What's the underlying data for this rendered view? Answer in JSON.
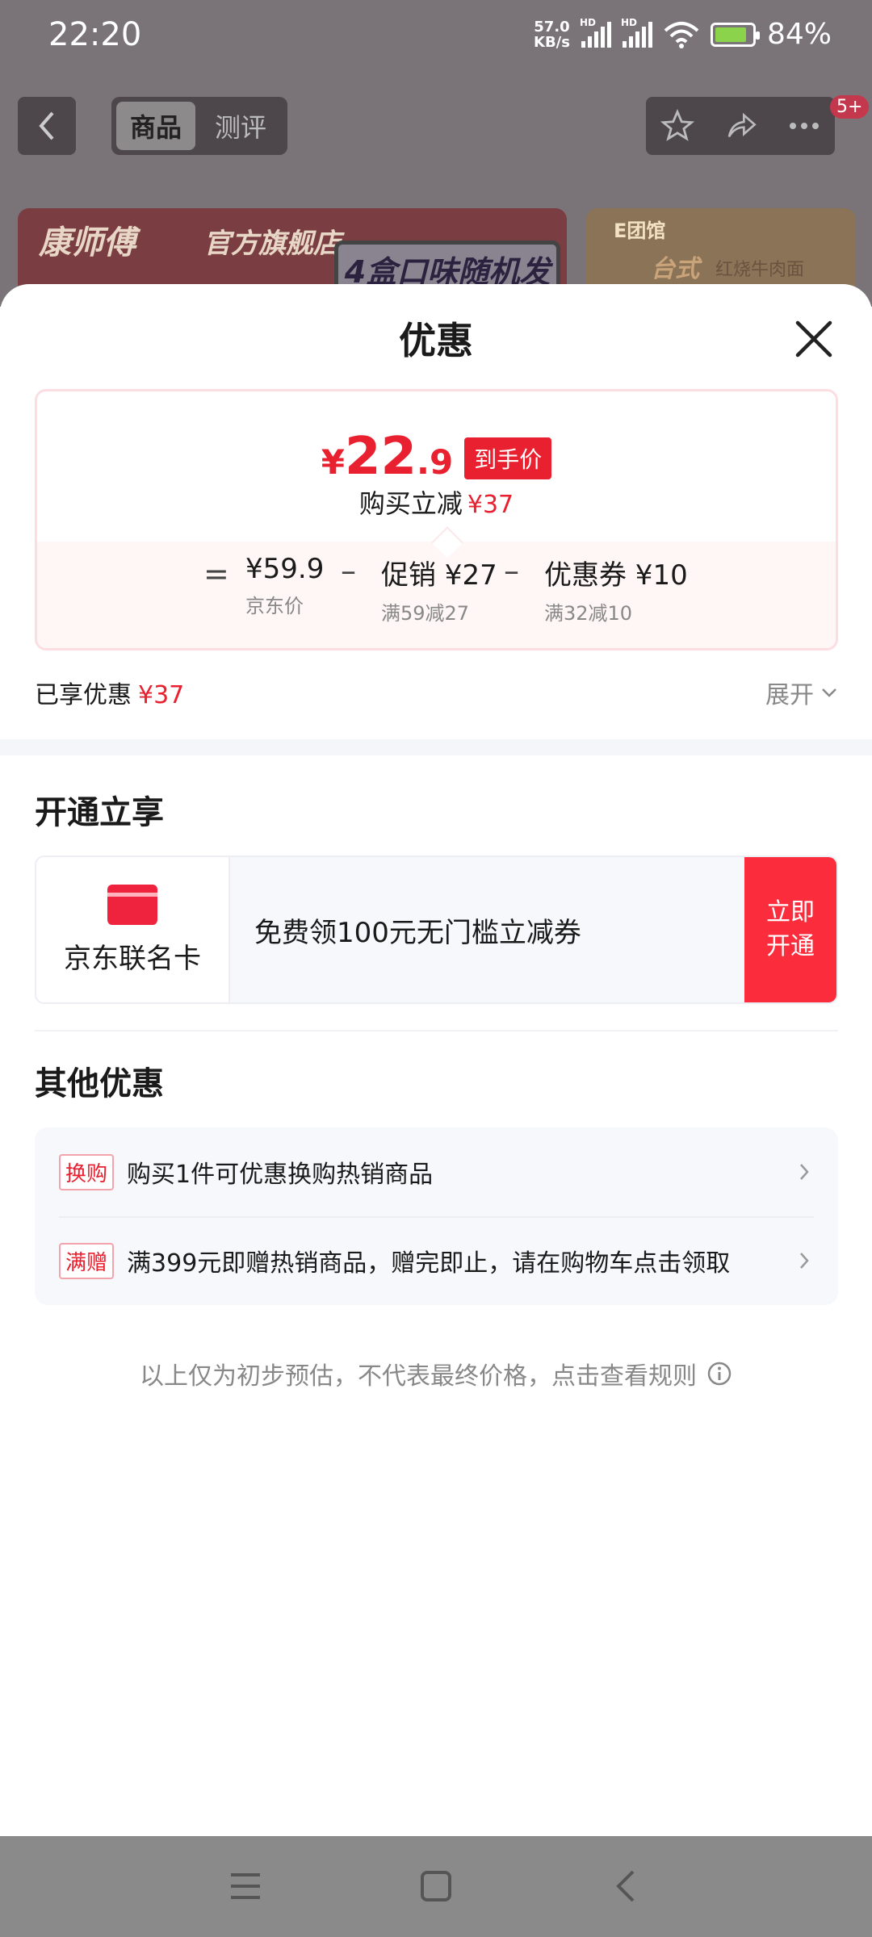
{
  "status_bar": {
    "time": "22:20",
    "net_speed_value": "57.0",
    "net_speed_unit": "KB/s",
    "sig1_label": "HD",
    "sig2_label": "HD",
    "battery": "84%"
  },
  "top_nav": {
    "tabs": [
      "商品",
      "测评"
    ],
    "active_tab": "商品",
    "badge": "5+"
  },
  "background_banners": {
    "left_brand": "康师傅",
    "left_flag": "官方旗舰店",
    "left_tag": "4盒口味随机发",
    "right_logo": "E团馆",
    "right_title": "台式",
    "right_sub": "红烧牛肉面"
  },
  "sheet": {
    "title": "优惠"
  },
  "price_card": {
    "currency": "¥",
    "price_int": "22",
    "price_dec": ".9",
    "final_label": "到手价",
    "reduce_label": "购买立减",
    "reduce_value": "¥37",
    "eq": "=",
    "minus": "–",
    "items": [
      {
        "value": "¥59.9",
        "caption": "京东价"
      },
      {
        "value": "促销 ¥27",
        "caption": "满59减27"
      },
      {
        "value": "优惠券 ¥10",
        "caption": "满32减10"
      }
    ]
  },
  "enjoyed": {
    "label": "已享优惠",
    "value": "¥37",
    "expand_label": "展开"
  },
  "open_section": {
    "title": "开通立享",
    "card_name": "京东联名卡",
    "offer": "免费领100元无门槛立减券",
    "cta": "立即开通"
  },
  "other_section": {
    "title": "其他优惠",
    "rows": [
      {
        "tag": "换购",
        "text": "购买1件可优惠换购热销商品"
      },
      {
        "tag": "满赠",
        "text": "满399元即赠热销商品，赠完即止，请在购物车点击领取"
      }
    ]
  },
  "disclaimer": "以上仅为初步预估，不代表最终价格，点击查看规则",
  "colors": {
    "accent_red": "#e8202f",
    "cta_red": "#fb2c3b",
    "muted_text": "#888888"
  }
}
